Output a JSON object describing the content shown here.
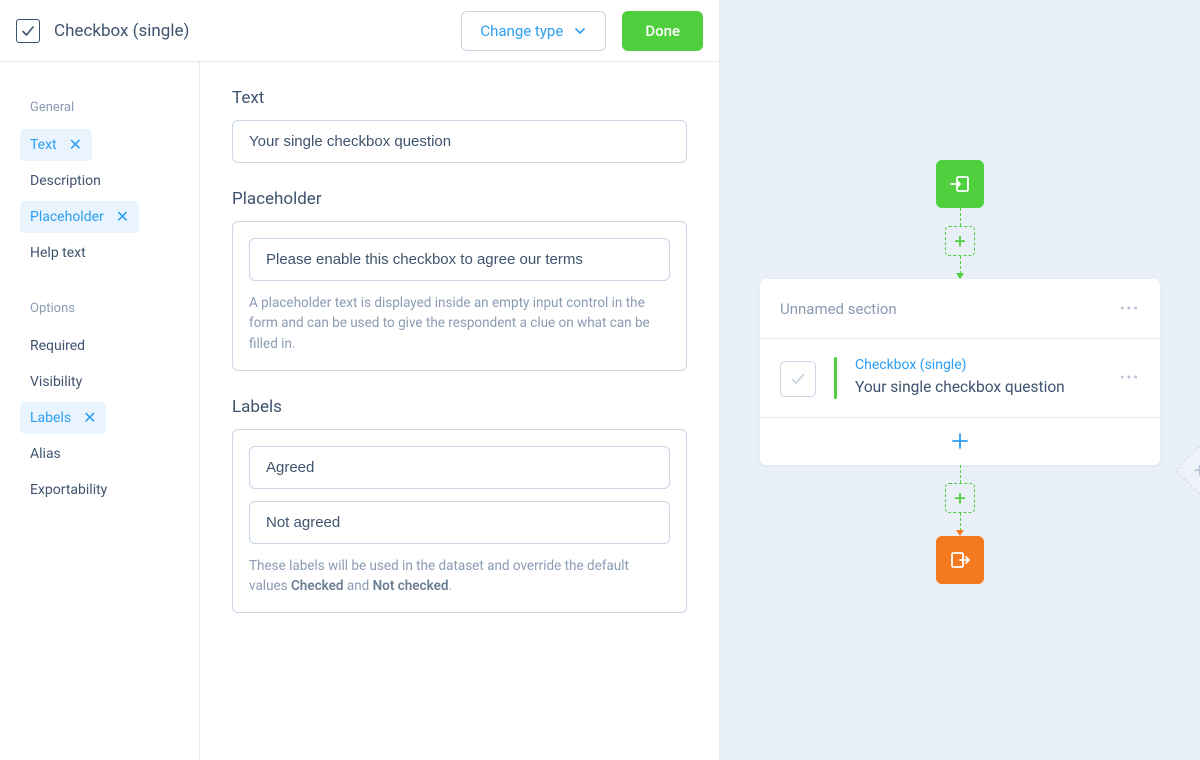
{
  "header": {
    "title": "Checkbox (single)",
    "change_type_label": "Change type",
    "done_label": "Done"
  },
  "sidebar": {
    "groups": [
      {
        "title": "General",
        "items": [
          {
            "label": "Text",
            "active": true,
            "removable": true
          },
          {
            "label": "Description",
            "active": false,
            "removable": false
          },
          {
            "label": "Placeholder",
            "active": true,
            "removable": true
          },
          {
            "label": "Help text",
            "active": false,
            "removable": false
          }
        ]
      },
      {
        "title": "Options",
        "items": [
          {
            "label": "Required",
            "active": false,
            "removable": false
          },
          {
            "label": "Visibility",
            "active": false,
            "removable": false
          },
          {
            "label": "Labels",
            "active": true,
            "removable": true
          },
          {
            "label": "Alias",
            "active": false,
            "removable": false
          },
          {
            "label": "Exportability",
            "active": false,
            "removable": false
          }
        ]
      }
    ]
  },
  "form": {
    "text": {
      "label": "Text",
      "value": "Your single checkbox question"
    },
    "placeholder": {
      "label": "Placeholder",
      "value": "Please enable this checkbox to agree our terms",
      "hint": "A placeholder text is displayed inside an empty input control in the form and can be used to give the respondent a clue on what can be filled in."
    },
    "labels": {
      "label": "Labels",
      "checked_value": "Agreed",
      "unchecked_value": "Not agreed",
      "hint_pre": "These labels will be used in the dataset and override the default values ",
      "hint_b1": "Checked",
      "hint_mid": " and ",
      "hint_b2": "Not checked",
      "hint_post": "."
    }
  },
  "preview": {
    "section_title": "Unnamed section",
    "question_type": "Checkbox (single)",
    "question_text": "Your single checkbox question"
  }
}
